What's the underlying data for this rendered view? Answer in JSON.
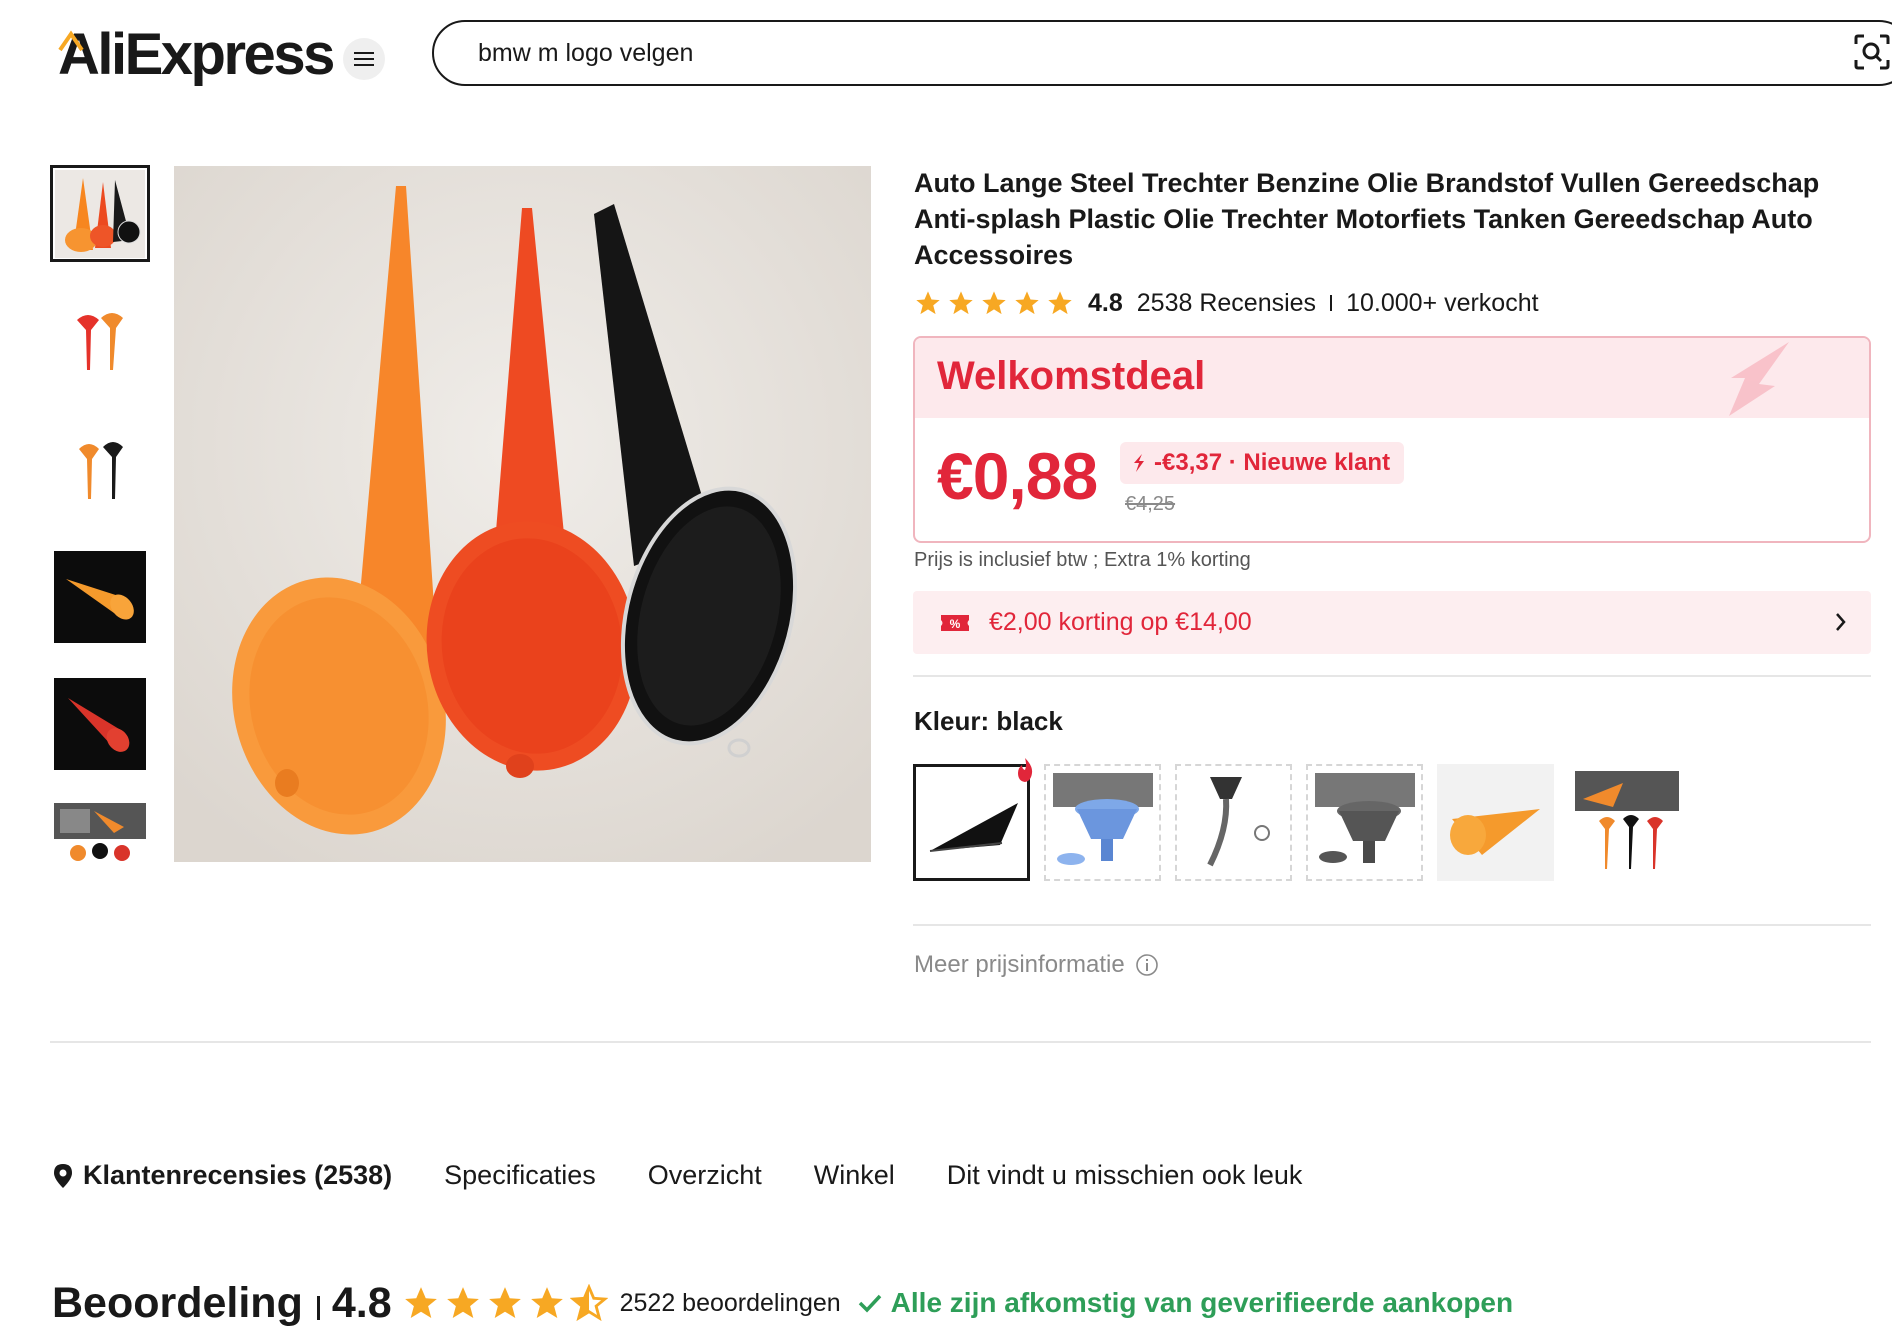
{
  "header": {
    "logo_text": "AliExpress",
    "search_value": "bmw m logo velgen"
  },
  "product": {
    "title": "Auto Lange Steel Trechter Benzine Olie Brandstof Vullen Gereedschap Anti-splash Plastic Olie Trechter Motorfiets Tanken Gereedschap Auto Accessoires",
    "rating": "4.8",
    "reviews_text": "2538 Recensies",
    "sold_text": "10.000+ verkocht",
    "rating_stars": 5
  },
  "deal": {
    "title": "Welkomstdeal",
    "price": "€0,88",
    "discount": "-€3,37 · Nieuwe klant",
    "old_price": "€4,25"
  },
  "tax_note": "Prijs is inclusief btw ; Extra 1% korting",
  "coupon": {
    "text": "€2,00 korting op €14,00"
  },
  "color": {
    "label": "Kleur: black",
    "selected": "black",
    "option_count": 6
  },
  "more_price_info": "Meer prijsinformatie",
  "tabs": [
    {
      "label": "Klantenrecensies (2538)",
      "active": true
    },
    {
      "label": "Specificaties"
    },
    {
      "label": "Overzicht"
    },
    {
      "label": "Winkel"
    },
    {
      "label": "Dit vindt u misschien ook leuk"
    }
  ],
  "reviews_summary": {
    "heading": "Beoordeling",
    "score": "4.8",
    "stars": 4.5,
    "count_text": "2522 beoordelingen",
    "verified_text": "Alle zijn afkomstig van geverifieerde aankopen"
  },
  "colors": {
    "accent": "#e1263a",
    "star": "#f7a823",
    "verified": "#2e9e58",
    "deal_bg": "#fde9ec"
  }
}
